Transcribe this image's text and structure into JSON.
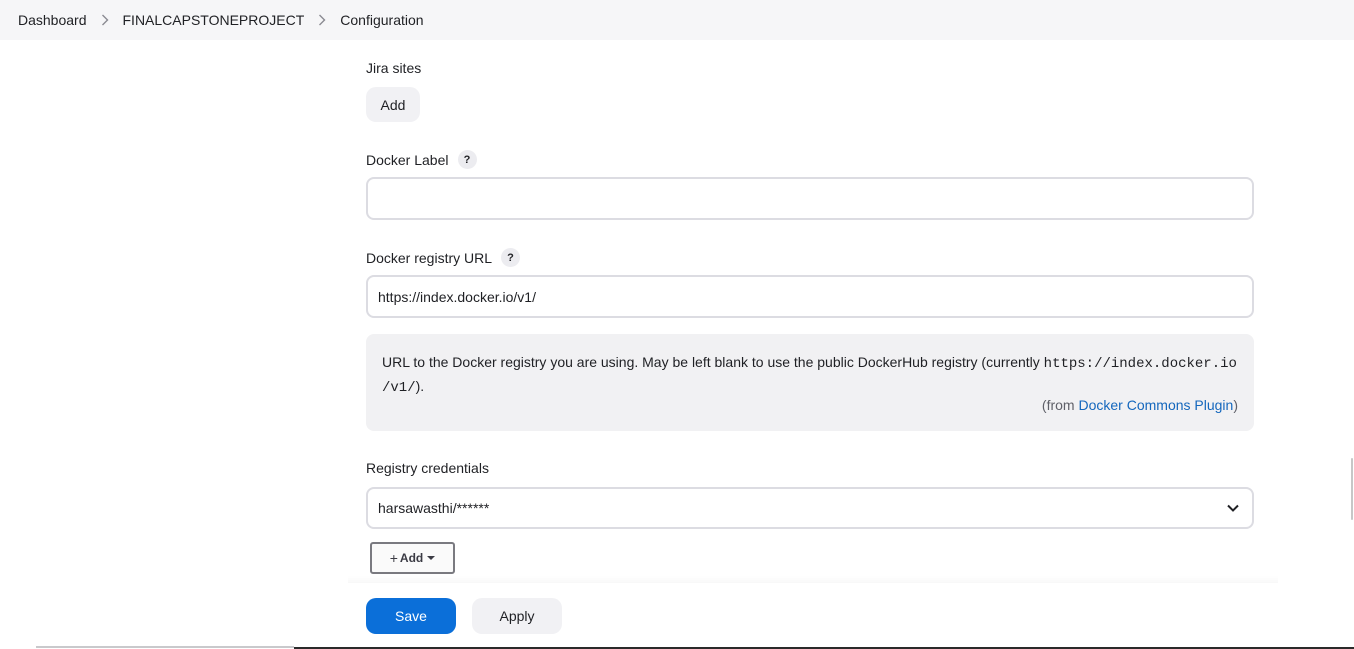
{
  "breadcrumb": {
    "items": [
      {
        "label": "Dashboard"
      },
      {
        "label": "FINALCAPSTONEPROJECT"
      },
      {
        "label": "Configuration"
      }
    ]
  },
  "jira": {
    "label": "Jira sites",
    "add_label": "Add"
  },
  "docker_label": {
    "label": "Docker Label",
    "help": "?",
    "value": ""
  },
  "docker_registry": {
    "label": "Docker registry URL",
    "help": "?",
    "value": "https://index.docker.io/v1/",
    "help_text_before": "URL to the Docker registry you are using. May be left blank to use the public DockerHub registry (currently ",
    "help_code_1": "https://index.docker.io",
    "help_code_2": "/v1/",
    "help_text_after": ").",
    "from_prefix": "(from ",
    "from_link": "Docker Commons Plugin",
    "from_suffix": ")"
  },
  "registry_credentials": {
    "label": "Registry credentials",
    "selected": "harsawasthi/******",
    "add_label": "Add"
  },
  "footer": {
    "save_label": "Save",
    "apply_label": "Apply"
  },
  "colors": {
    "primary": "#0b6fd9",
    "link": "#1467bd",
    "breadcrumb_bg": "#f6f6f8"
  }
}
